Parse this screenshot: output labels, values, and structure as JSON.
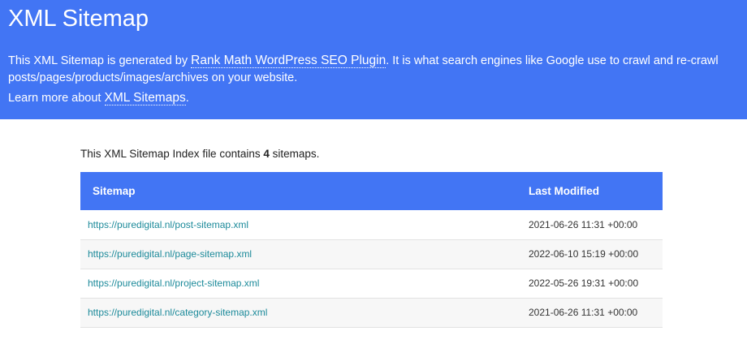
{
  "header": {
    "title": "XML Sitemap",
    "intro_before_link": "This XML Sitemap is generated by ",
    "plugin_link": "Rank Math WordPress SEO Plugin",
    "intro_after_link": ". It is what search engines like Google use to crawl and re-crawl posts/pages/products/images/archives on your website.",
    "learn_before_link": "Learn more about ",
    "learn_link": "XML Sitemaps",
    "learn_after_link": "."
  },
  "summary": {
    "before_count": "This XML Sitemap Index file contains ",
    "count": "4",
    "after_count": " sitemaps."
  },
  "table": {
    "columns": [
      "Sitemap",
      "Last Modified"
    ],
    "rows": [
      {
        "url": "https://puredigital.nl/post-sitemap.xml",
        "modified": "2021-06-26 11:31 +00:00"
      },
      {
        "url": "https://puredigital.nl/page-sitemap.xml",
        "modified": "2022-06-10 15:19 +00:00"
      },
      {
        "url": "https://puredigital.nl/project-sitemap.xml",
        "modified": "2022-05-26 19:31 +00:00"
      },
      {
        "url": "https://puredigital.nl/category-sitemap.xml",
        "modified": "2021-06-26 11:31 +00:00"
      }
    ]
  },
  "colors": {
    "header_bg": "#4275f4",
    "link": "#1c8a9a"
  }
}
